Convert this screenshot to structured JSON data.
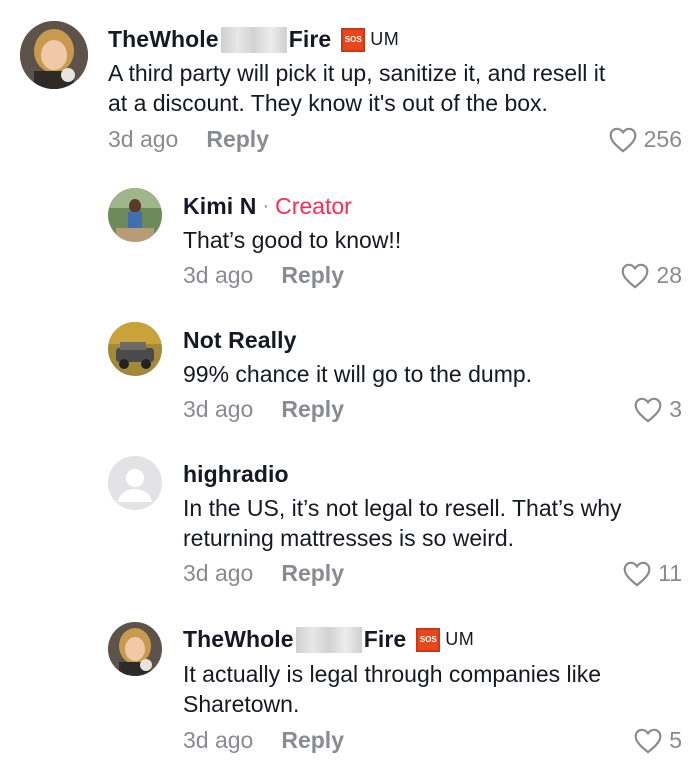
{
  "comments": [
    {
      "username_left": "TheWhole",
      "username_right": "Fire",
      "badge_icon": "sos-badge-icon",
      "badge_icon_text": "SOS",
      "badge_text": "UM",
      "text_lines": [
        "A third party will pick it up, sanitize it, and resell it",
        "at a discount. They know it's out of the box."
      ],
      "time": "3d ago",
      "reply": "Reply",
      "likes": "256"
    },
    {
      "username": "Kimi N",
      "separator": "·",
      "creator_label": "Creator",
      "text_lines": [
        "That’s good to know!!"
      ],
      "time": "3d ago",
      "reply": "Reply",
      "likes": "28"
    },
    {
      "username": "Not Really",
      "text_lines": [
        "99% chance it will go to the dump."
      ],
      "time": "3d ago",
      "reply": "Reply",
      "likes": "3"
    },
    {
      "username": "highradio",
      "text_lines": [
        "In the US, it’s not legal to resell. That’s why",
        "returning mattresses is so weird."
      ],
      "time": "3d ago",
      "reply": "Reply",
      "likes": "11"
    },
    {
      "username_left": "TheWhole",
      "username_right": "Fire",
      "badge_icon": "sos-badge-icon",
      "badge_icon_text": "SOS",
      "badge_text": "UM",
      "text_lines": [
        "It actually is legal through companies like",
        "Sharetown."
      ],
      "time": "3d ago",
      "reply": "Reply",
      "likes": "5"
    }
  ],
  "colors": {
    "creator": "#fe2c55",
    "muted": "#8a8b91",
    "badge": "#e8471c",
    "text": "#161823"
  }
}
